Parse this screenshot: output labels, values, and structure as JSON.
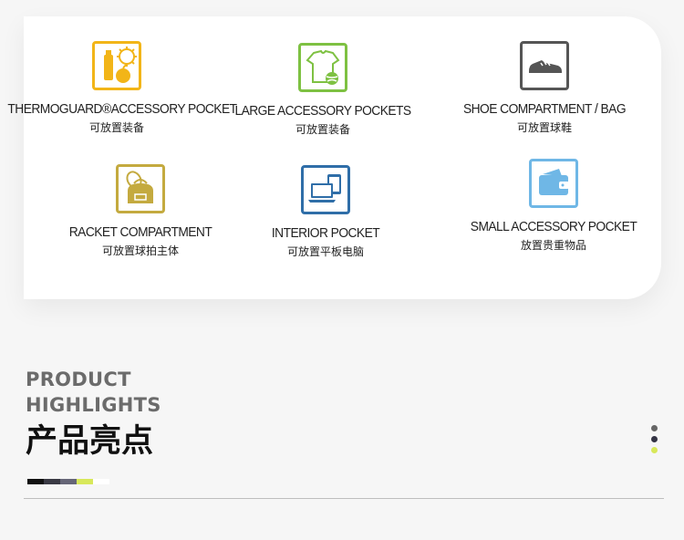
{
  "features": [
    {
      "title": "THERMOGUARD®ACCESSORY POCKET",
      "subtitle": "可放置装备",
      "icon": "thermoguard-bottle-icon",
      "color": "#f2b518"
    },
    {
      "title": "LARGE ACCESSORY POCKETS",
      "subtitle": "可放置装备",
      "icon": "shirt-ball-icon",
      "color": "#7ec142"
    },
    {
      "title": "SHOE COMPARTMENT / BAG",
      "subtitle": "可放置球鞋",
      "icon": "shoe-icon",
      "color": "#555555"
    },
    {
      "title": "RACKET COMPARTMENT",
      "subtitle": "可放置球拍主体",
      "icon": "racket-bag-icon",
      "color": "#c4aa3f"
    },
    {
      "title": "INTERIOR POCKET",
      "subtitle": "可放置平板电脑",
      "icon": "laptop-tablet-icon",
      "color": "#2f6ea8"
    },
    {
      "title": "SMALL ACCESSORY POCKET",
      "subtitle": "放置贵重物品",
      "icon": "wallet-icon",
      "color": "#6fb7e6"
    }
  ],
  "highlights": {
    "title_en_line1": "PRODUCT",
    "title_en_line2": "HIGHLIGHTS",
    "title_cn": "产品亮点"
  },
  "color_bar": [
    "#111111",
    "#3a3a44",
    "#666677",
    "#d8e85a",
    "#ffffff"
  ],
  "dots": [
    "#666666",
    "#333344",
    "#d8e85a"
  ]
}
